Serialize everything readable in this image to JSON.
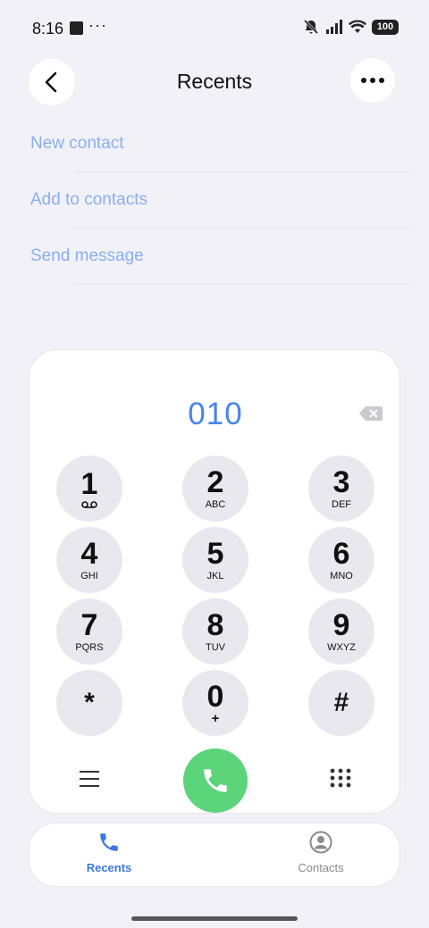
{
  "status_bar": {
    "time": "8:16",
    "overflow": "···",
    "battery": "100",
    "icons": [
      "notification-square-icon",
      "silent-bell-icon",
      "signal-icon",
      "wifi-icon",
      "battery-icon"
    ]
  },
  "header": {
    "title": "Recents",
    "back_icon": "chevron-left-icon",
    "more_icon": "more-dots-icon"
  },
  "actions": [
    {
      "label": "New contact"
    },
    {
      "label": "Add to contacts"
    },
    {
      "label": "Send message"
    }
  ],
  "dialer": {
    "number": "010",
    "backspace_icon": "backspace-icon",
    "keys": [
      {
        "digit": "1",
        "letters": "",
        "icon": "voicemail-icon"
      },
      {
        "digit": "2",
        "letters": "ABC"
      },
      {
        "digit": "3",
        "letters": "DEF"
      },
      {
        "digit": "4",
        "letters": "GHI"
      },
      {
        "digit": "5",
        "letters": "JKL"
      },
      {
        "digit": "6",
        "letters": "MNO"
      },
      {
        "digit": "7",
        "letters": "PQRS"
      },
      {
        "digit": "8",
        "letters": "TUV"
      },
      {
        "digit": "9",
        "letters": "WXYZ"
      },
      {
        "digit": "*",
        "letters": ""
      },
      {
        "digit": "0",
        "letters": "+"
      },
      {
        "digit": "#",
        "letters": ""
      }
    ],
    "bottom": {
      "menu_icon": "menu-icon",
      "call_icon": "phone-icon",
      "keypad_icon": "keypad-grid-icon"
    }
  },
  "tabs": [
    {
      "label": "Recents",
      "icon": "phone-icon",
      "active": true
    },
    {
      "label": "Contacts",
      "icon": "person-icon",
      "active": false
    }
  ],
  "colors": {
    "accent": "#4a85e8",
    "action_text": "#8ab0ec",
    "call_green": "#5bd47a",
    "background": "#f1f1f7",
    "key_background": "#e8e8ee"
  }
}
